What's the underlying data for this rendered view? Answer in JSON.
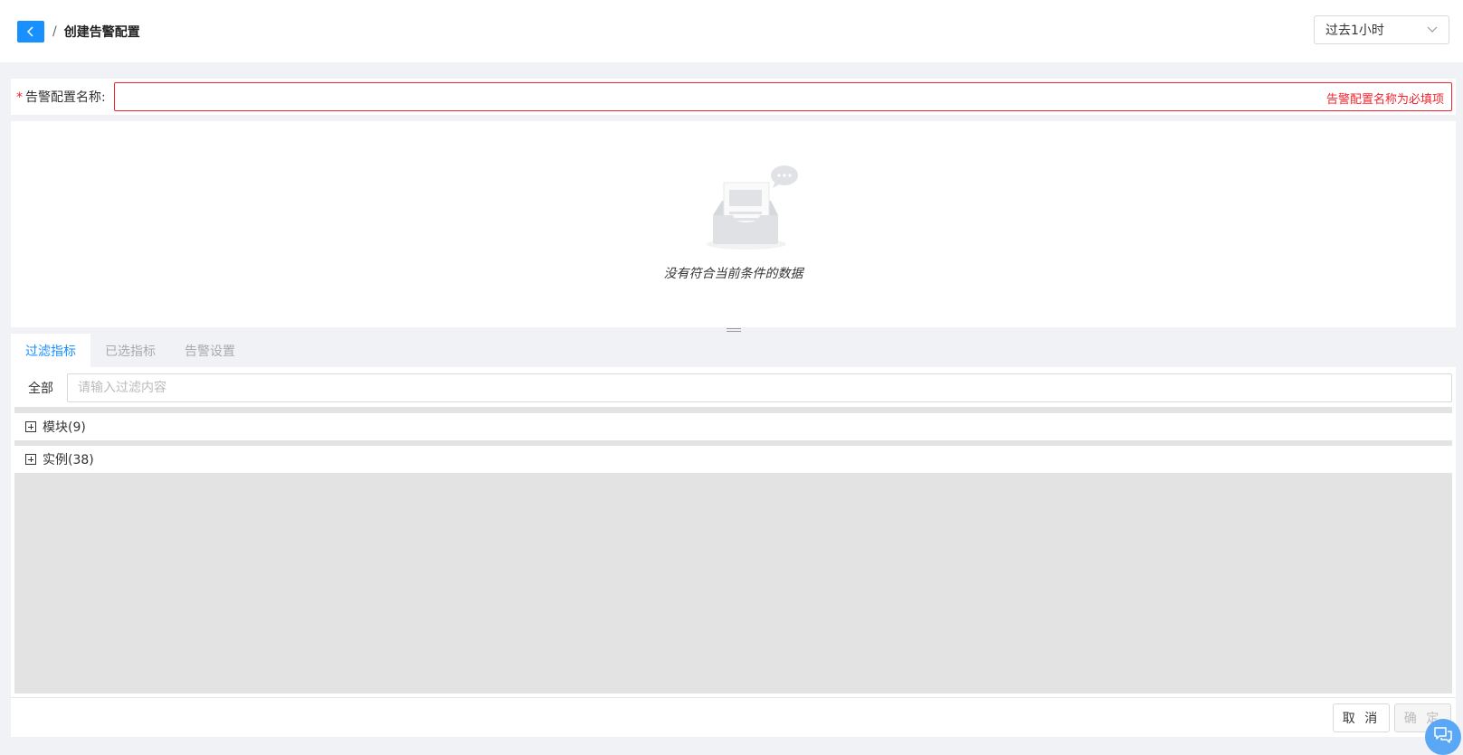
{
  "header": {
    "breadcrumb_separator": "/",
    "title": "创建告警配置",
    "back_icon": "chevron-left-icon",
    "time_range": "过去1小时",
    "time_range_icon": "chevron-down-icon"
  },
  "form": {
    "required_mark": "*",
    "name_label": "告警配置名称:",
    "name_value": "",
    "name_error": "告警配置名称为必填项"
  },
  "empty_state": {
    "icon": "empty-inbox-icon",
    "message": "没有符合当前条件的数据"
  },
  "tabs": [
    {
      "label": "过滤指标",
      "active": true
    },
    {
      "label": "已选指标",
      "active": false
    },
    {
      "label": "告警设置",
      "active": false
    }
  ],
  "filter": {
    "scope_label": "全部",
    "placeholder": "请输入过滤内容"
  },
  "tree": [
    {
      "label": "模块(9)",
      "icon": "plus-square-icon"
    },
    {
      "label": "实例(38)",
      "icon": "plus-square-icon"
    }
  ],
  "footer": {
    "cancel_label": "取 消",
    "ok_label": "确 定",
    "chat_icon": "chat-icon"
  },
  "colors": {
    "primary": "#1890ff",
    "error": "#f5222d",
    "background": "#f0f2f5"
  }
}
